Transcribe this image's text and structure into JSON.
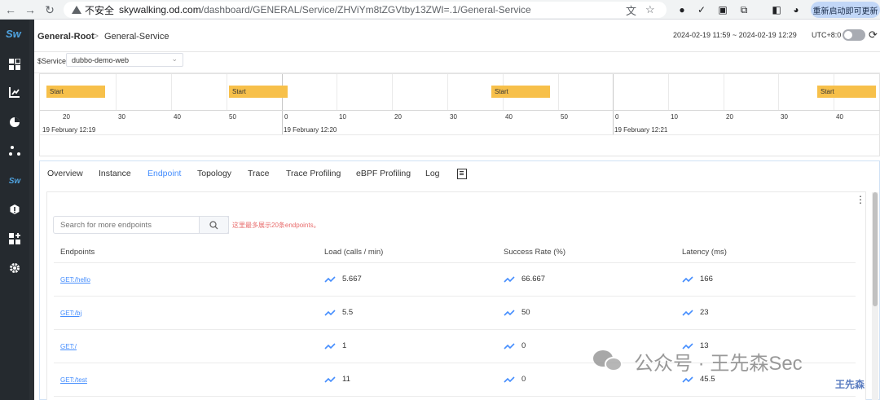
{
  "browser": {
    "insecure_label": "不安全",
    "url_host": "skywalking.od.com",
    "url_path": "/dashboard/GENERAL/Service/ZHViYm8tZGVtby13ZWI=.1/General-Service",
    "update_button": "重新启动即可更新",
    "icons": [
      "back-icon",
      "forward-icon",
      "reload-icon",
      "translate-icon",
      "star-icon",
      "extension-icon",
      "extension-icon",
      "puzzle-icon",
      "sidepanel-icon",
      "profile-icon"
    ]
  },
  "sidebar": {
    "logo": "Sw",
    "logo2": "Sw",
    "items": [
      "dashboard-icon",
      "chart-icon",
      "pie-icon",
      "topology-icon",
      "skywalking-icon",
      "alarm-icon",
      "add-widget-icon",
      "settings-icon"
    ]
  },
  "header": {
    "root": "General-Root",
    "separator": ">",
    "current": "General-Service",
    "time_range": "2024-02-19 11:59 ~ 2024-02-19 12:29",
    "utc": "UTC+8:0"
  },
  "service": {
    "label": "$Service",
    "value": "dubbo-demo-web"
  },
  "timeline": {
    "start_label": "Start",
    "ticks": [
      "20",
      "30",
      "40",
      "50",
      "0",
      "10",
      "20",
      "30",
      "40",
      "50",
      "0",
      "10",
      "20",
      "30",
      "40"
    ],
    "days": [
      "19 February 12:19",
      "19 February 12:20",
      "19 February 12:21"
    ]
  },
  "tabs": [
    "Overview",
    "Instance",
    "Endpoint",
    "Topology",
    "Trace",
    "Trace Profiling",
    "eBPF Profiling",
    "Log"
  ],
  "active_tab": "Endpoint",
  "endpoint_panel": {
    "search_placeholder": "Search for more endpoints",
    "note": "这里最多展示20条endpoints。",
    "columns": [
      "Endpoints",
      "Load (calls / min)",
      "Success Rate (%)",
      "Latency (ms)"
    ],
    "rows": [
      {
        "endpoint": "GET:/hello",
        "load": "5.667",
        "success": "66.667",
        "latency": "166"
      },
      {
        "endpoint": "GET:/bj",
        "load": "5.5",
        "success": "50",
        "latency": "23"
      },
      {
        "endpoint": "GET:/",
        "load": "1",
        "success": "0",
        "latency": "13"
      },
      {
        "endpoint": "GET:/test",
        "load": "11",
        "success": "0",
        "latency": "45.5"
      }
    ]
  },
  "watermark": {
    "text": "公众号 · 王先森Sec",
    "corner": "王先森"
  },
  "colors": {
    "accent": "#448dfe",
    "start_box": "#f7c04a",
    "sidebar": "#252a2f",
    "note": "#e86b6b"
  }
}
